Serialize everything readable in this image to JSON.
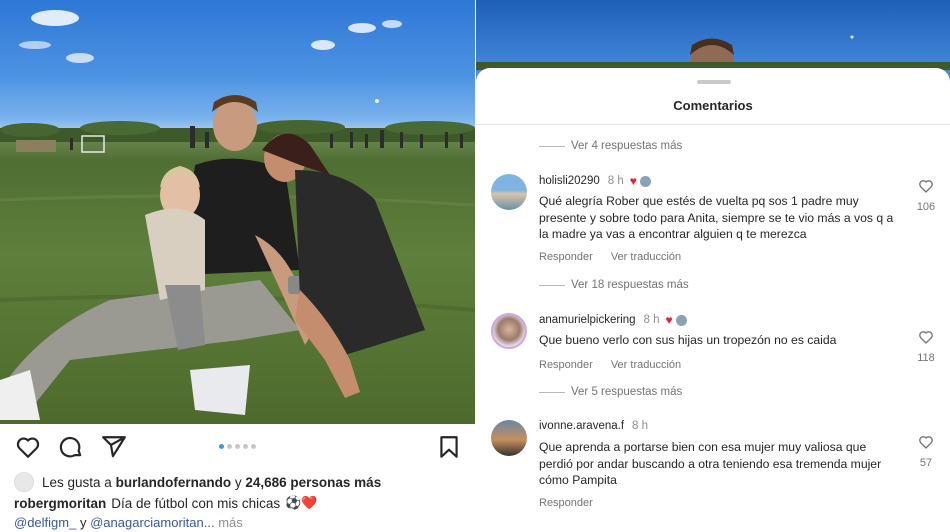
{
  "post": {
    "carousel": {
      "total": 5,
      "active": 1
    },
    "likes": {
      "prefix": "Les gusta a",
      "user": "burlandofernando",
      "middle": "y",
      "count": "24,686 personas más"
    },
    "caption": {
      "user": "robergmoritan",
      "text": "Día de fútbol con mis chicas",
      "emojis": "⚽❤️"
    },
    "tags": {
      "tag1": "@delfigm_",
      "joiner": "y",
      "tag2": "@anagarciamoritan...",
      "more": "más"
    },
    "icons": [
      "heart-icon",
      "comment-icon",
      "share-icon",
      "bookmark-icon"
    ]
  },
  "comments_sheet": {
    "title": "Comentarios",
    "items": [
      {
        "kind": "more",
        "text": "Ver 4 respuestas más"
      },
      {
        "kind": "comment",
        "user": "holisli20290",
        "time": "8 h",
        "text": "Qué alegría Rober que estés de vuelta pq sos 1 padre muy presente y sobre todo para Anita, siempre se te vio más a vos q a la madre ya vas a encontrar alguien q te merezca",
        "reply": "Responder",
        "translate": "Ver traducción",
        "likes": "106"
      },
      {
        "kind": "more",
        "text": "Ver 18 respuestas más"
      },
      {
        "kind": "comment",
        "user": "anamurielpickering",
        "time": "8 h",
        "text": "Que bueno verlo con sus hijas un tropezón no es caida",
        "reply": "Responder",
        "translate": "Ver traducción",
        "likes": "118"
      },
      {
        "kind": "more",
        "text": "Ver 5 respuestas más"
      },
      {
        "kind": "comment",
        "user": "ivonne.aravena.f",
        "time": "8 h",
        "text": "Que aprenda  a portarse  bien con esa mujer  muy valiosa que perdió  por andar  buscando a otra teniendo  esa tremenda  mujer cómo  Pampita",
        "reply": "Responder",
        "likes": "57"
      }
    ]
  },
  "colors": {
    "sky": "#3b82d8",
    "grass": "#56733a",
    "heart_red": "#ed1c3a",
    "link_blue": "#385898",
    "muted": "#737373",
    "carousel_active": "#3897f0"
  }
}
